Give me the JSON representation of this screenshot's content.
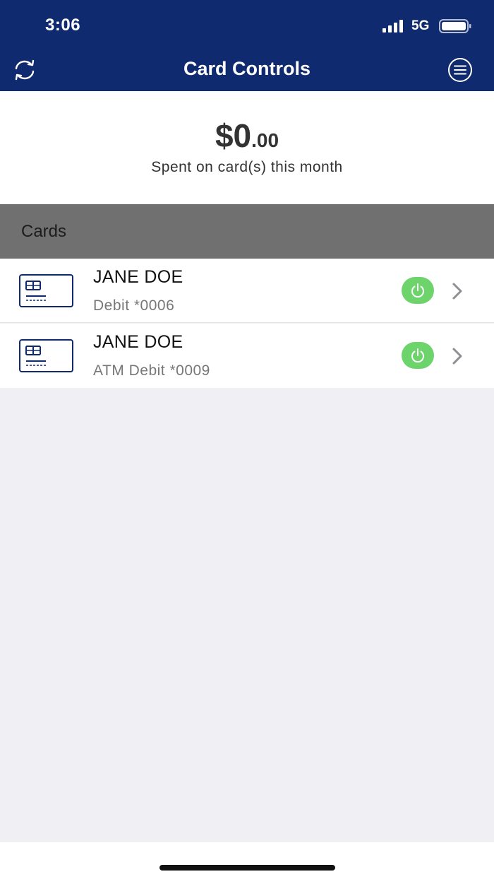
{
  "status_bar": {
    "time": "3:06",
    "network": "5G"
  },
  "nav": {
    "title": "Card Controls",
    "left_icon": "refresh-icon",
    "right_icon": "menu-icon"
  },
  "colors": {
    "brand": "#0f2a6e",
    "toggle_on": "#6cd46b",
    "section_header": "#707070",
    "background": "#efeff4"
  },
  "summary": {
    "amount_whole": "$0",
    "amount_cents": ".00",
    "caption": "Spent on card(s) this month"
  },
  "cards_section": {
    "title": "Cards",
    "items": [
      {
        "name": "JANE DOE",
        "description": "Debit *0006",
        "enabled": true,
        "icon": "credit-card-icon"
      },
      {
        "name": "JANE DOE",
        "description": "ATM Debit *0009",
        "enabled": true,
        "icon": "credit-card-icon"
      }
    ]
  }
}
